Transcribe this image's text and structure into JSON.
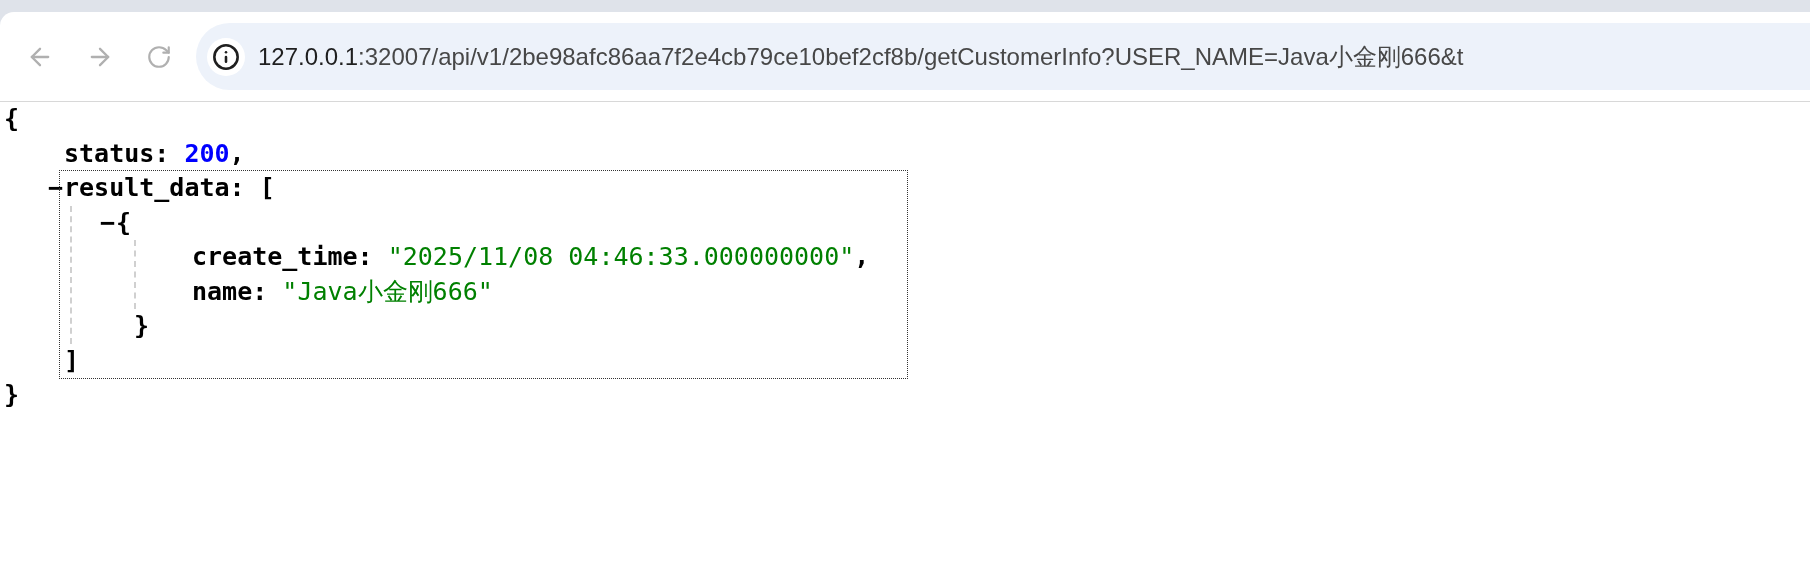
{
  "toolbar": {
    "back_disabled": true,
    "forward_disabled": true,
    "url_host": "127.0.0.1",
    "url_rest": ":32007/api/v1/2be98afc86aa7f2e4cb79ce10bef2cf8b/getCustomerInfo?USER_NAME=Java小金刚666&t"
  },
  "json_view": {
    "open": "{",
    "close": "}",
    "entries": [
      {
        "kind": "number",
        "key": "status:",
        "value": "200",
        "separator": ","
      },
      {
        "kind": "array",
        "key": "result_data:",
        "open": "[",
        "close": "]",
        "toggle": "−",
        "expanded": true,
        "highlighted": true,
        "items": [
          {
            "toggle": "−",
            "expanded": true,
            "open": "{",
            "close": "}",
            "entries": [
              {
                "kind": "string",
                "key": "create_time:",
                "value": "\"2025/11/08 04:46:33.000000000\"",
                "separator": ","
              },
              {
                "kind": "string",
                "key": "name:",
                "value": "\"Java小金刚666\""
              }
            ]
          }
        ]
      }
    ]
  }
}
